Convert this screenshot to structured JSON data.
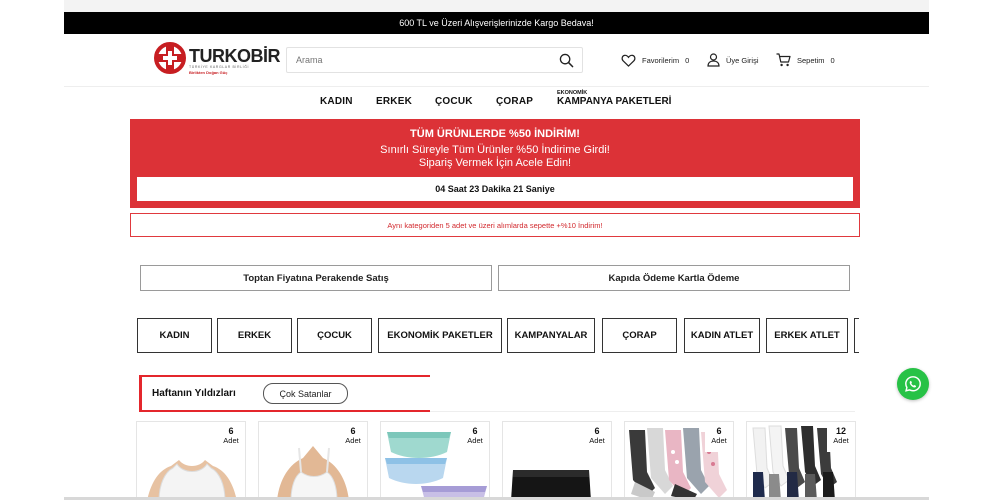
{
  "shipping_bar": {
    "text": "600 TL ve Üzeri Alışverişlerinizde Kargo Bedava!"
  },
  "logo": {
    "title": "TURKOBİR",
    "subtitle": "TÜRKİYE KARGLAR BİRLİĞİ",
    "slogan": "Birlikten Doğan Güç"
  },
  "search": {
    "placeholder": "Arama"
  },
  "header_links": {
    "favorites": {
      "label": "Favorilerim",
      "count": "0"
    },
    "login": {
      "label": "Üye Girişi"
    },
    "cart": {
      "label": "Sepetim",
      "count": "0"
    }
  },
  "nav": {
    "items": [
      "KADIN",
      "ERKEK",
      "ÇOCUK",
      "ÇORAP"
    ],
    "campaign_small": "EKONOMİK",
    "campaign_big": "KAMPANYA PAKETLERİ"
  },
  "promo": {
    "line1": "TÜM ÜRÜNLERDE %50 İNDİRİM!",
    "line2": "Sınırlı Süreyle Tüm Ürünler %50 İndirime Girdi!",
    "line3": "Sipariş Vermek İçin Acele Edin!",
    "countdown": "04 Saat 23 Dakika 21 Saniye"
  },
  "notice": "Aynı kategoriden 5 adet ve üzeri alımlarda sepette +%10 İndirim!",
  "features": [
    "Toptan Fiyatına Perakende Satış",
    "Kapıda Ödeme Kartla Ödeme"
  ],
  "categories": [
    "KADIN",
    "ERKEK",
    "ÇOCUK",
    "EKONOMİK PAKETLER",
    "KAMPANYALAR",
    "ÇORAP",
    "KADIN ATLET",
    "ERKEK ATLET"
  ],
  "tabs": {
    "active": "Haftanın Yıldızları",
    "other": "Çok Satanlar"
  },
  "products": [
    {
      "qty": "6",
      "unit": "Adet"
    },
    {
      "qty": "6",
      "unit": "Adet"
    },
    {
      "qty": "6",
      "unit": "Adet"
    },
    {
      "qty": "6",
      "unit": "Adet"
    },
    {
      "qty": "6",
      "unit": "Adet"
    },
    {
      "qty": "12",
      "unit": "Adet"
    }
  ],
  "colors": {
    "brand_red": "#dc3237",
    "whatsapp_green": "#27c246",
    "bar_black": "#000000"
  },
  "icons": [
    "heart-icon",
    "user-icon",
    "cart-icon",
    "search-icon",
    "whatsapp-icon"
  ]
}
